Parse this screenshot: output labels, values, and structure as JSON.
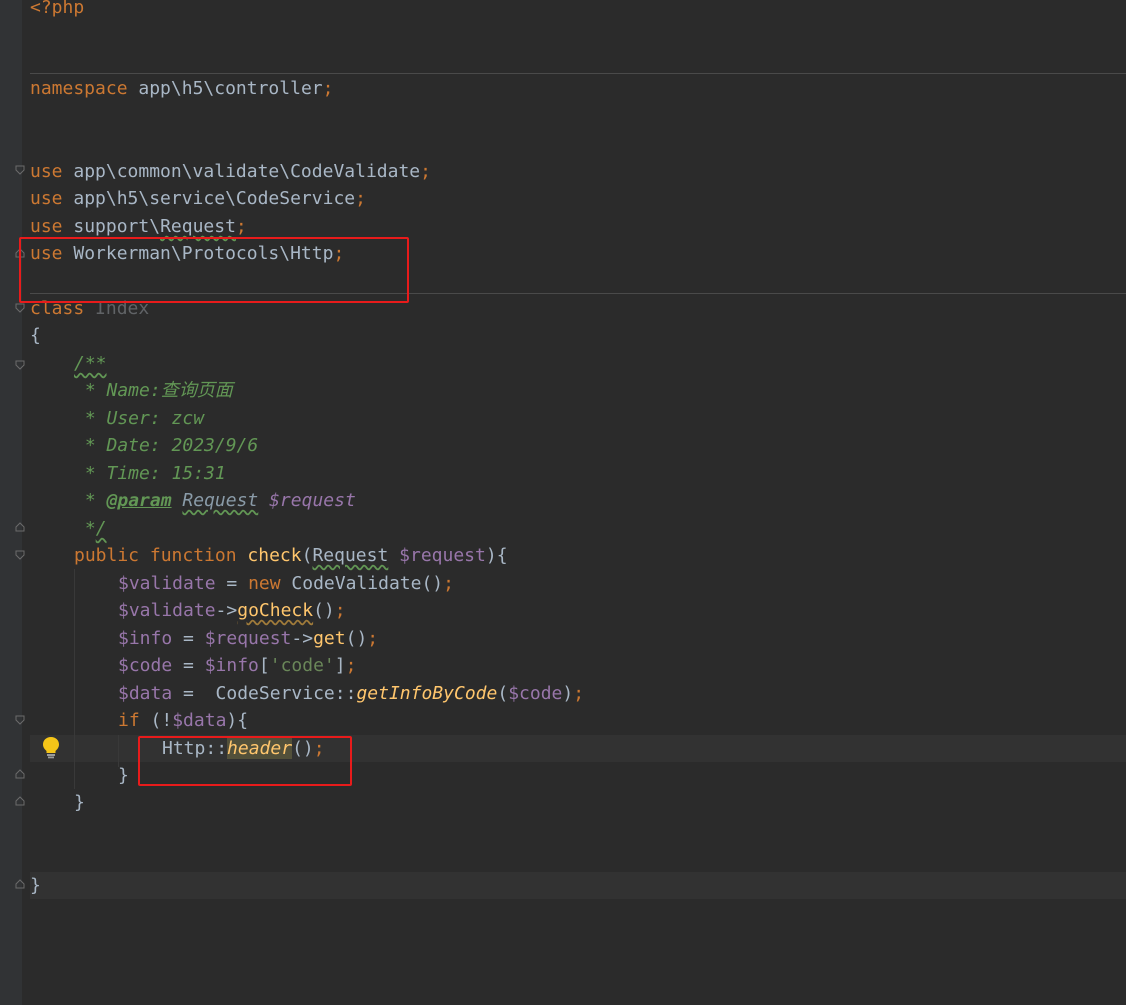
{
  "editor": {
    "language": "PHP",
    "colors": {
      "background": "#2b2b2b",
      "keyword": "#cc7832",
      "variable": "#9876aa",
      "function": "#ffc66d",
      "string": "#6a8759",
      "doc_comment": "#629755",
      "plain": "#a9b7c6",
      "annotation_box": "#e81b1b"
    },
    "tokens": {
      "php_open": "<?php",
      "namespace_kw": "namespace",
      "namespace_name": " app\\h5\\controller",
      "use_kw": "use",
      "use1_path": " app\\common\\validate\\CodeValidate",
      "use2_path": " app\\h5\\service\\CodeService",
      "use3_path_a": " support\\",
      "use3_path_b": "Request",
      "use4_path": " Workerman\\Protocols\\Http",
      "semicolon": ";",
      "class_kw": "class",
      "class_name": " Index",
      "brace_open": "{",
      "brace_close": "}",
      "doc_open": "/**",
      "doc_name": " * Name:查询页面",
      "doc_user": " * User: zcw",
      "doc_date": " * Date: 2023/9/6",
      "doc_time": " * Time: 15:31",
      "doc_star": " * ",
      "doc_param_tag": "@param",
      "doc_param_type": "Request",
      "doc_param_var": "$request",
      "doc_close_star": " *",
      "doc_close_slash": "/",
      "public_kw": "public",
      "function_kw": "function",
      "fn_check": "check",
      "paren_open": "(",
      "paren_close": ")",
      "type_request": "Request",
      "var_request": "$request",
      "var_validate": "$validate",
      "assign": " = ",
      "assign2": " =  ",
      "new_kw": "new",
      "class_codevalidate": "CodeValidate",
      "empty_parens": "()",
      "arrow": "->",
      "fn_gocheck": "goCheck",
      "var_info": "$info",
      "fn_get": "get",
      "var_code": "$code",
      "bracket_open": "[",
      "bracket_close": "]",
      "str_code": "'code'",
      "var_data": "$data",
      "class_codeservice": "CodeService",
      "scope": "::",
      "fn_getinfobycode": "getInfoByCode",
      "if_kw": "if",
      "not_paren": "(!",
      "class_http": "Http",
      "fn_header": "header"
    }
  }
}
